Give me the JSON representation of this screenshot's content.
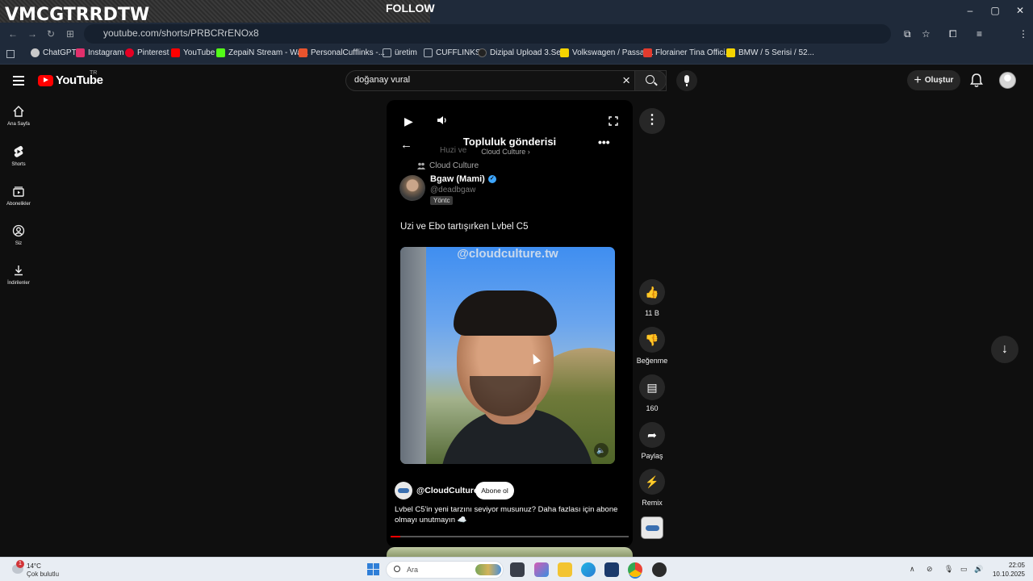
{
  "overlay": {
    "title": "VMCGTRRDTW",
    "follow": "FOLLOW"
  },
  "browser": {
    "url": "youtube.com/shorts/PRBCRrENOx8",
    "window_controls": [
      "–",
      "▢",
      "✕"
    ],
    "bookmarks": [
      {
        "label": "ChatGPT",
        "color": "#c9c9c9"
      },
      {
        "label": "Instagram",
        "color": "#e1306c"
      },
      {
        "label": "Pinterest",
        "color": "#e60023"
      },
      {
        "label": "YouTube",
        "color": "#ff0000"
      },
      {
        "label": "ZepaiN Stream - Wa...",
        "color": "#53fc18"
      },
      {
        "label": "PersonalCufflinks -...",
        "color": "#e8542e"
      },
      {
        "label": "üretim",
        "color": "#aab3bd"
      },
      {
        "label": "CUFFLINKS",
        "color": "#aab3bd"
      },
      {
        "label": "Dizipal Upload 3.Se...",
        "color": "#222222"
      },
      {
        "label": "Volkswagen / Passat...",
        "color": "#f5d400"
      },
      {
        "label": "Florainer Tina Offici...",
        "color": "#e23b2e"
      },
      {
        "label": "BMW / 5 Serisi / 52...",
        "color": "#f5d400"
      }
    ]
  },
  "youtube": {
    "logo": "YouTube",
    "region": "TR",
    "search_query": "doğanay vural",
    "create_label": "Oluştur",
    "nav": [
      {
        "label": "Ana Sayfa",
        "icon": "home-icon"
      },
      {
        "label": "Shorts",
        "icon": "shorts-icon"
      },
      {
        "label": "Abonelikler",
        "icon": "subscriptions-icon"
      },
      {
        "label": "Siz",
        "icon": "account-icon"
      },
      {
        "label": "İndirilenler",
        "icon": "download-icon"
      }
    ]
  },
  "post": {
    "header_title": "Topluluk gönderisi",
    "header_sub": "Cloud Culture ›",
    "ghost_text": "Huzi ve",
    "channel": "Cloud Culture",
    "author_name": "Bgaw (Mami)",
    "author_handle": "@deadbgaw",
    "author_badge": "Yöntc",
    "text": "Uzi ve Ebo tartışırken Lvbel C5",
    "image_watermark": "@cloudculture.tw"
  },
  "footer": {
    "channel": "@CloudCulturee",
    "subscribe": "Abone ol",
    "description": "Lvbel C5'in yeni tarzını seviyor musunuz? Daha fazlası için abone olmayı unutmayın ☁️",
    "progress": 0.04
  },
  "actions": {
    "like_count": "11 B",
    "dislike_label": "Beğenme",
    "comment_count": "160",
    "share_label": "Paylaş",
    "remix_label": "Remix"
  },
  "taskbar": {
    "temperature": "14°C",
    "weather": "Çok bulutlu",
    "notification_count": "1",
    "search_placeholder": "Ara",
    "time": "22:05",
    "date": "10.10.2025"
  }
}
